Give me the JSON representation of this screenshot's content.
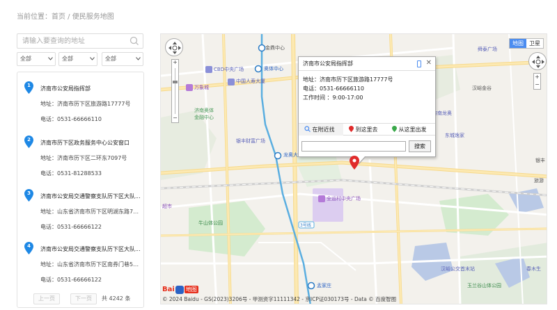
{
  "breadcrumb": "当前位置：首页 / 便民服务地图",
  "search": {
    "placeholder": "请输入要查询的地址"
  },
  "filters": [
    "全部",
    "全部",
    "全部"
  ],
  "list": [
    {
      "num": "1",
      "name": "济南市公安局指挥部",
      "address": "地址：济南市历下区旅游路17777号",
      "phone": "电话：0531-66666110"
    },
    {
      "num": "2",
      "name": "济南市历下区政务服务中心公安窗口",
      "address": "地址：济南市历下区二环东7097号",
      "phone": "电话：0531-81288533"
    },
    {
      "num": "3",
      "name": "济南市公安局交通警察支队历下区大队...",
      "address": "地址：山东省济南市历下区明湖东路79...",
      "phone": "电话：0531-66666122"
    },
    {
      "num": "4",
      "name": "济南市公安局交通警察支队历下区大队...",
      "address": "地址：山东省济南市历下区南券门巷53...",
      "phone": "电话：0531-66666122"
    }
  ],
  "pager": {
    "prev": "上一页",
    "next": "下一页",
    "total": "共 4242 条"
  },
  "map": {
    "type_labels": {
      "map": "地图",
      "satellite": "卫星"
    },
    "popup": {
      "title": "济南市公安局指挥部",
      "close": "✕",
      "address": "地址：济南市历下区旅游路17777号",
      "phone": "电话：0531-66666110",
      "hours": "工作时间 ：9:00-17:00",
      "tab_nearby": "在附近找",
      "tab_to": "到这里去",
      "tab_from": "从这里出发",
      "search_button": "搜索"
    },
    "labels": {
      "jinding": "金鼎中心",
      "olympic": "奥体中心",
      "cbd": "CBD中央广场",
      "wanxiang": "万象城",
      "chinalife": "中国人寿大厦",
      "jinanolympic": "济南奥体",
      "jinrongcheng": "金融中心",
      "yinfeng": "银丰财富广场",
      "longao": "龙奥大",
      "quanyun": "全运村中央广场",
      "chaoshi": "超市",
      "niushan": "牛山体公园",
      "mengjiazhuang": "孟家庄",
      "shengshi": "舜泰广场",
      "hanyu": "汉峪金谷",
      "longao_r": "济南龙奥",
      "donghua": "东城逸家",
      "lvyou": "旅游",
      "yinfeng_r": "银丰",
      "hanyu_park": "汉峪公交首末站",
      "yujia": "玉兰谷山体公园",
      "chunmu": "春木生",
      "line3": "3号线",
      "jinanhutong": "济南东"
    },
    "copyright": "© 2024 Baidu - GS(2023)3206号 - 甲测资字11111342 - 京ICP证030173号 - Data © 百度智图",
    "logo": {
      "bai": "Bai",
      "map": "地图"
    }
  },
  "colors": {
    "accent": "#1e88e5",
    "road_major": "#fce9b2",
    "road_minor": "#ffffff",
    "park": "#cfe9cc",
    "water": "#a9c8f0",
    "metro": "#4aa0d8",
    "marker": "#e02b2b"
  }
}
